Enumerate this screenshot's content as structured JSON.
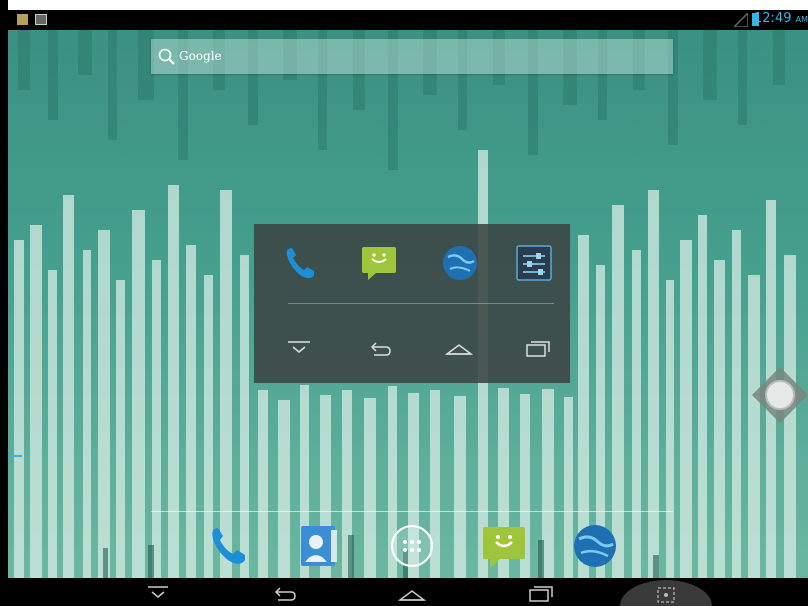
{
  "status_bar": {
    "time": "12:49",
    "ampm": "AM"
  },
  "search": {
    "label": "Google"
  },
  "overlay": {
    "apps": [
      {
        "name": "phone-icon"
      },
      {
        "name": "messaging-icon"
      },
      {
        "name": "browser-icon"
      },
      {
        "name": "settings-icon"
      }
    ],
    "nav": [
      {
        "name": "hide-keyboard-icon"
      },
      {
        "name": "back-icon"
      },
      {
        "name": "home-icon"
      },
      {
        "name": "recent-apps-icon"
      }
    ]
  },
  "dock": [
    {
      "name": "phone-icon"
    },
    {
      "name": "contacts-icon"
    },
    {
      "name": "app-drawer-icon"
    },
    {
      "name": "messaging-icon"
    },
    {
      "name": "browser-icon"
    }
  ],
  "colors": {
    "accent": "#33b5e5",
    "wallpaper_top": "#3a8f80",
    "wallpaper_bottom": "#6fb9a3"
  }
}
